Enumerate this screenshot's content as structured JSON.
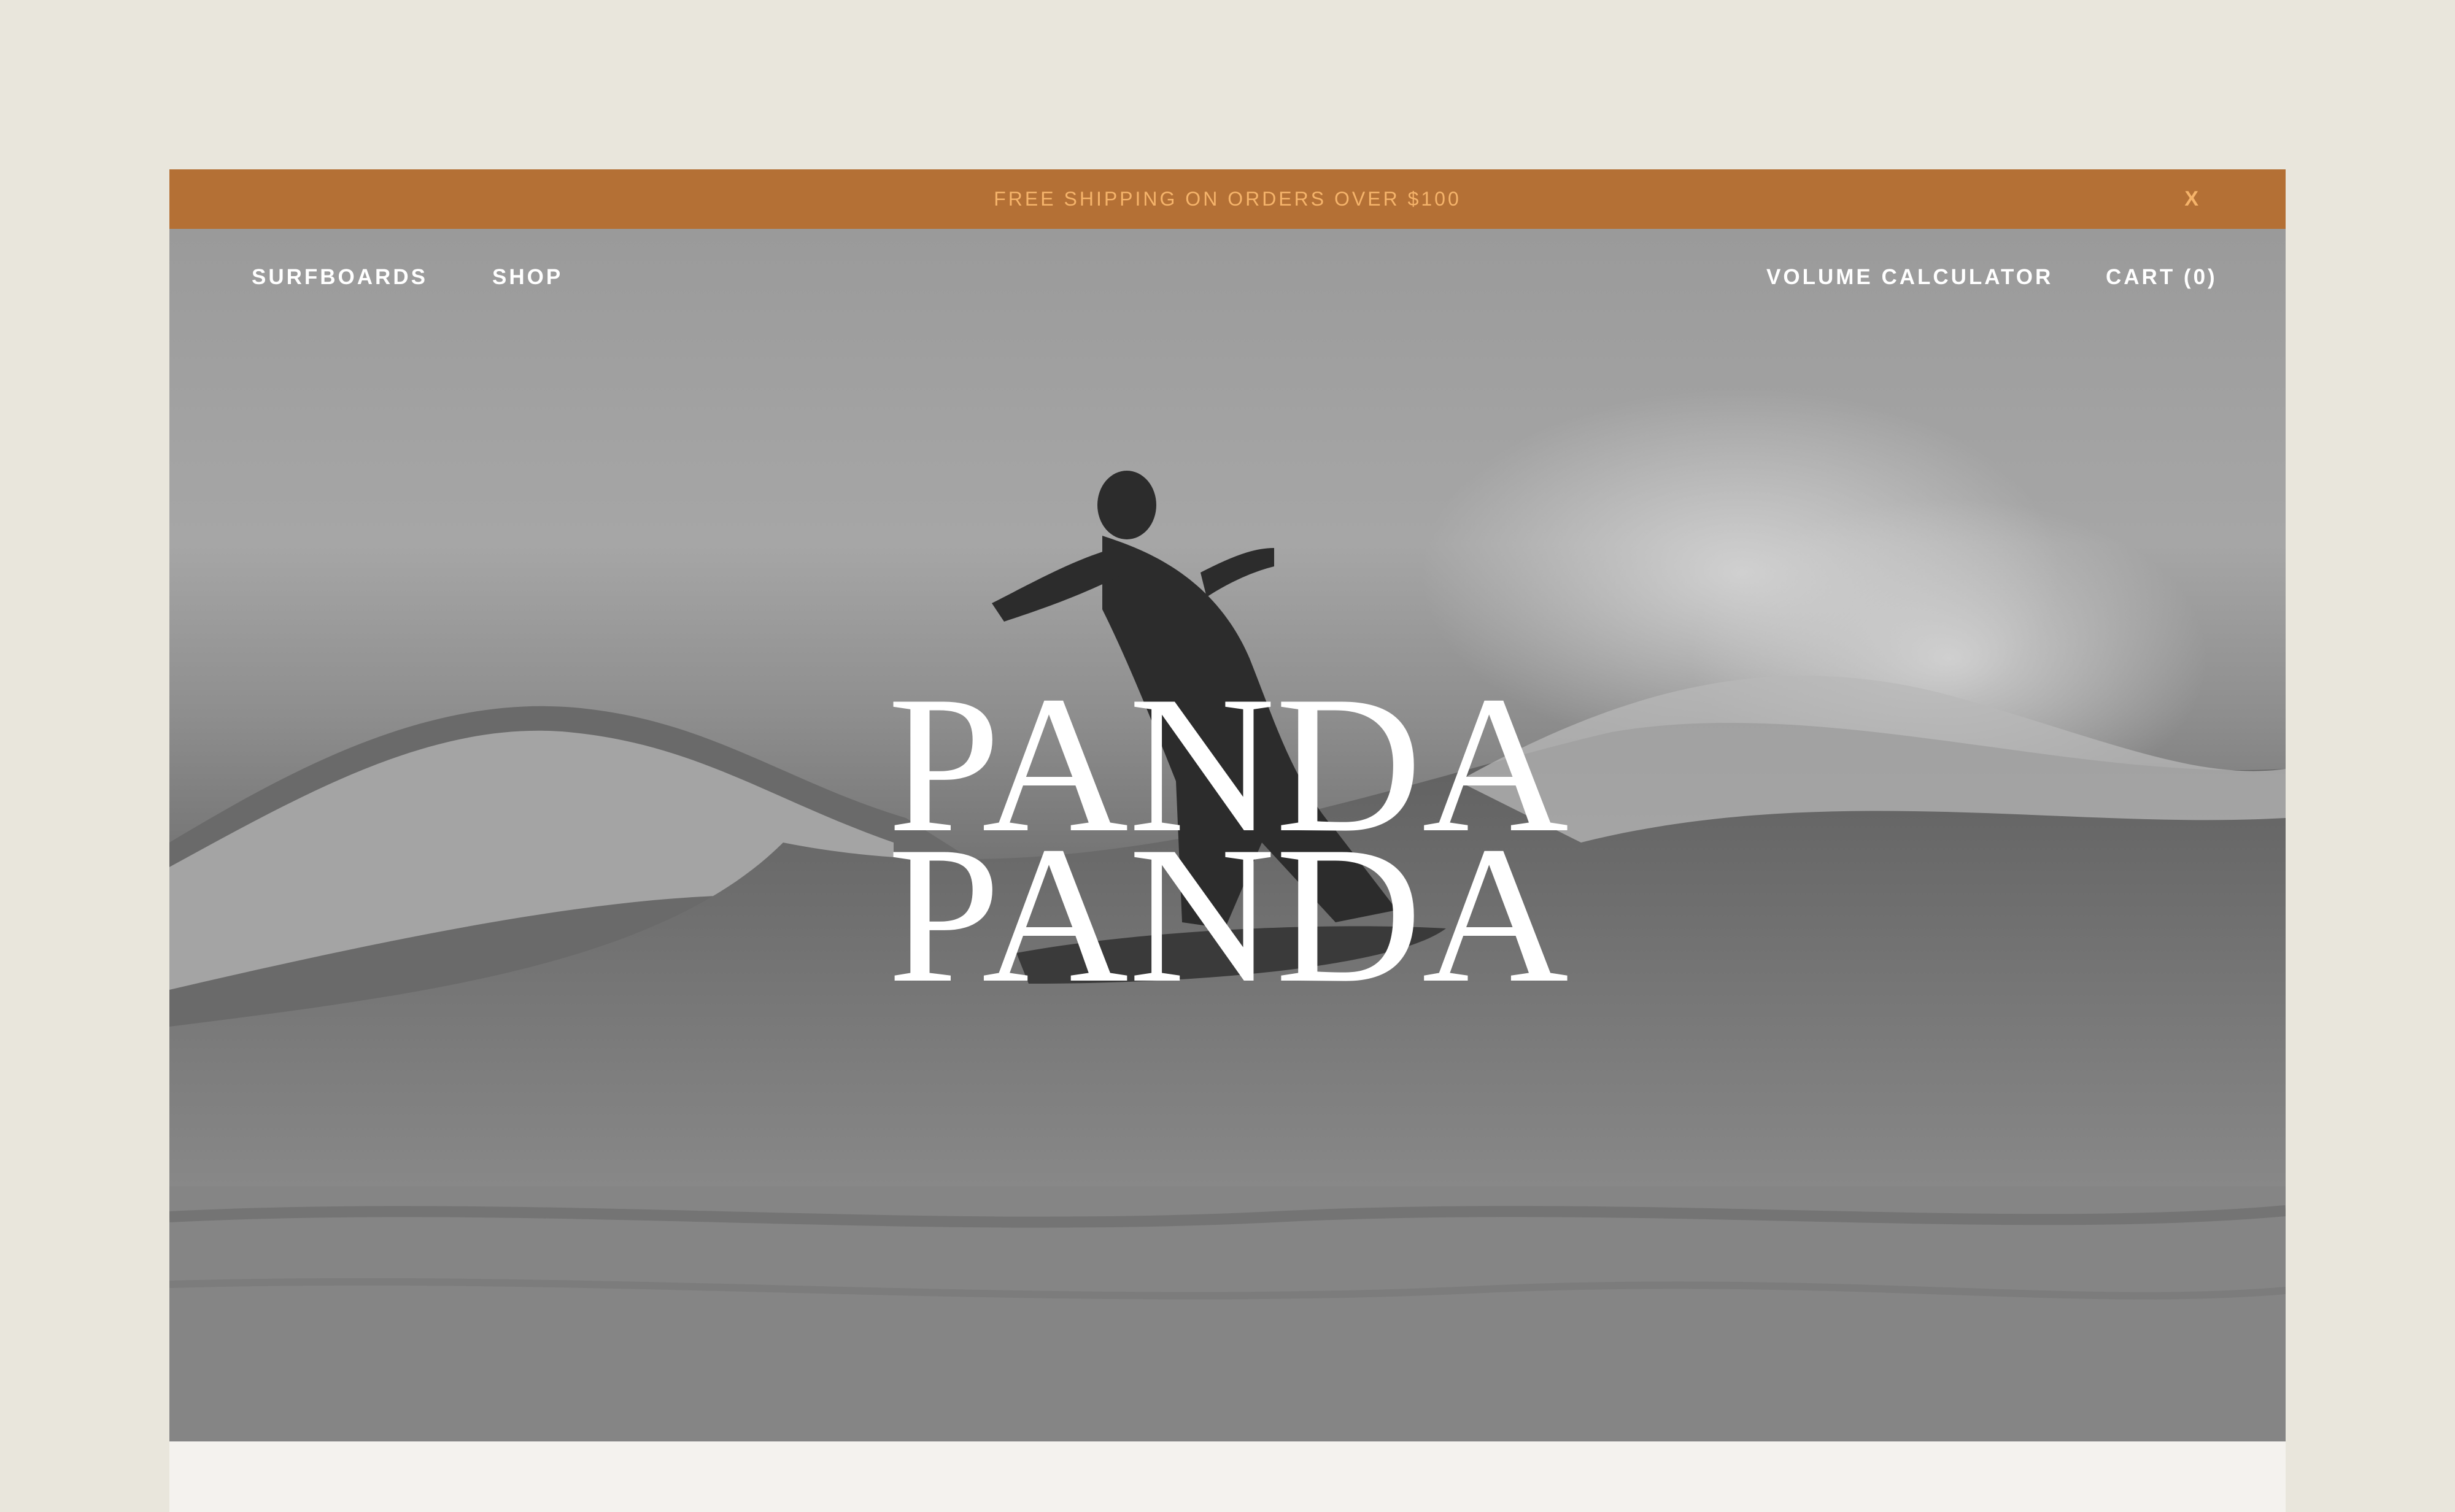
{
  "announcement": {
    "text": "FREE SHIPPING ON ORDERS OVER $100",
    "close_label": "X"
  },
  "nav": {
    "left": [
      {
        "label": "SURFBOARDS"
      },
      {
        "label": "SHOP"
      }
    ],
    "right": [
      {
        "label": "VOLUME CALCULATOR"
      },
      {
        "label": "CART (0)"
      }
    ]
  },
  "hero": {
    "logo_text": "PANDA"
  },
  "colors": {
    "page_background": "#E9E6DC",
    "announcement_bar": "#B47035",
    "announcement_text": "#F5B36A",
    "nav_text": "#FFFFFF",
    "content_background": "#F4F2EE"
  }
}
